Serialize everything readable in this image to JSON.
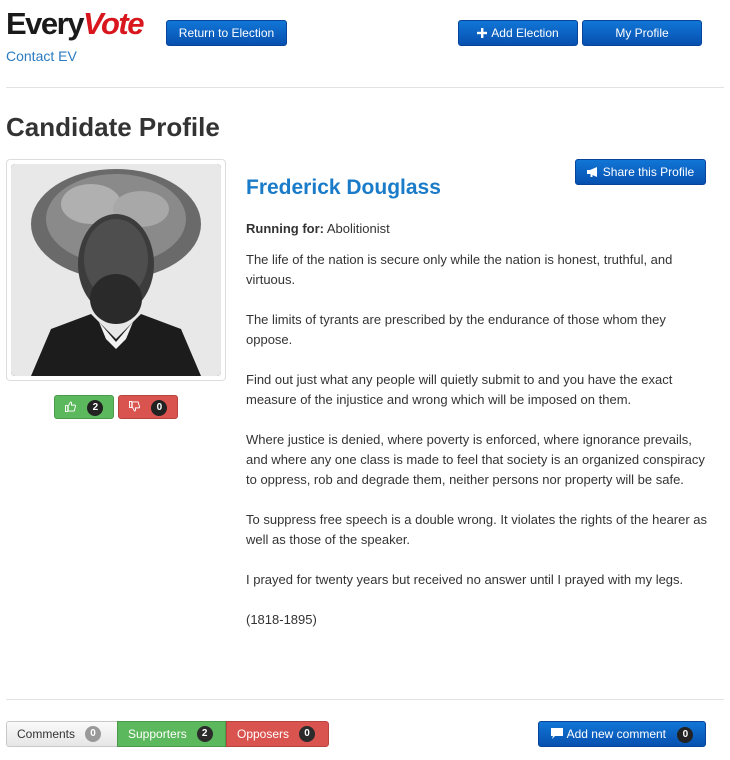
{
  "header": {
    "logo_every": "Every",
    "logo_vote": "Vote",
    "contact_link": "Contact EV",
    "return_button": "Return to Election",
    "add_election_button": "Add Election",
    "my_profile_button": "My Profile"
  },
  "page": {
    "title": "Candidate Profile"
  },
  "candidate": {
    "name": "Frederick Douglass",
    "running_for_label": "Running for:",
    "running_for_value": "Abolitionist",
    "share_button": "Share this Profile",
    "upvotes": "2",
    "downvotes": "0",
    "bio": [
      "The life of the nation is secure only while the nation is honest, truthful, and virtuous.",
      "The limits of tyrants are prescribed by the endurance of those whom they oppose.",
      "Find out just what any people will quietly submit to and you have the exact measure of the injustice and wrong which will be imposed on them.",
      "Where justice is denied, where poverty is enforced, where ignorance prevails, and where any one class is made to feel that society is an organized conspiracy to oppress, rob and degrade them, neither persons nor property will be safe.",
      "To suppress free speech is a double wrong. It violates the rights of the hearer as well as those of the speaker.",
      "I prayed for twenty years but received no answer until I prayed with my legs.",
      "(1818-1895)"
    ]
  },
  "tabs": {
    "comments_label": "Comments",
    "comments_count": "0",
    "supporters_label": "Supporters",
    "supporters_count": "2",
    "opposers_label": "Opposers",
    "opposers_count": "0"
  },
  "add_comment": {
    "label": "Add new comment",
    "count": "0"
  },
  "colors": {
    "brand_red": "#d9161d",
    "link_blue": "#2a7bc0",
    "button_blue": "#0a63c8",
    "support_green": "#5cb85c",
    "oppose_red": "#d9534f"
  },
  "icons": {
    "plus": "plus-icon",
    "megaphone": "megaphone-icon",
    "thumbs_up": "thumbs-up-icon",
    "thumbs_down": "thumbs-down-icon",
    "comment": "comment-icon"
  }
}
